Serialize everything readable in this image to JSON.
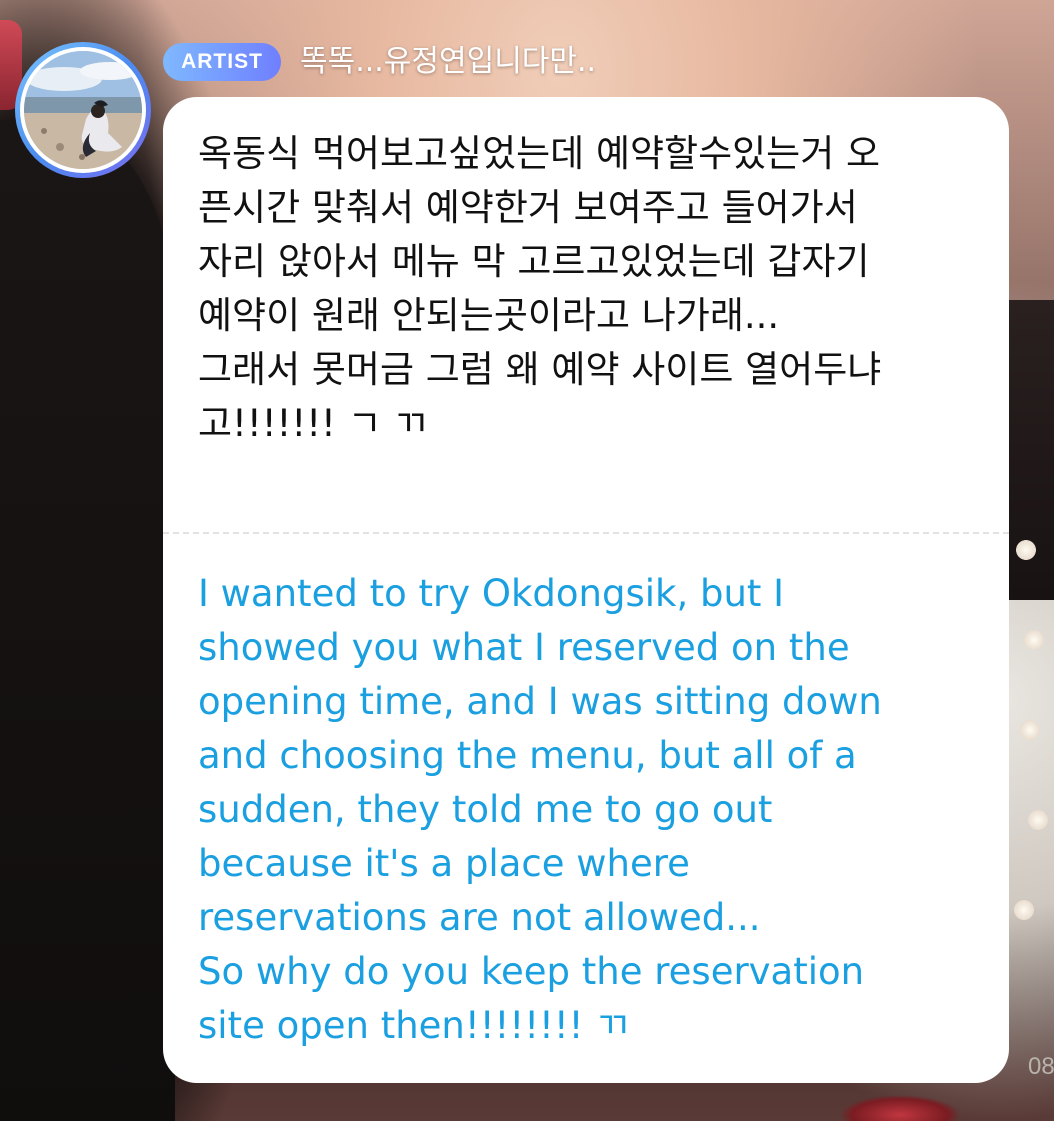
{
  "message": {
    "badge": "ARTIST",
    "sender_name": "똑똑...유정연입니다만..",
    "original_text": "옥동식 먹어보고싶었는데 예약할수있는거 오\n픈시간 맞춰서 예약한거 보여주고 들어가서\n자리 앉아서 메뉴 막 고르고있었는데 갑자기\n예약이 원래 안되는곳이라고 나가래...\n그래서 못머금 그럼 왜 예약 사이트 열어두냐\n고!!!!!!! ㄱ ㄲ",
    "translated_text": "I wanted to try Okdongsik, but I\nshowed you what I reserved on the\nopening time, and I was sitting down\nand choosing the menu, but all of a\nsudden, they told me to go out\nbecause it's a place where\nreservations are not allowed...\nSo why do you keep the reservation\nsite open then!!!!!!!! ㄲ",
    "timestamp_partial": "08"
  },
  "colors": {
    "badge_gradient_start": "#7fb8ff",
    "badge_gradient_end": "#6f7fff",
    "translation_text": "#1a9fe0",
    "bubble_background": "#ffffff",
    "original_text": "#111111"
  },
  "icons": {
    "avatar": "profile-photo-beach"
  }
}
